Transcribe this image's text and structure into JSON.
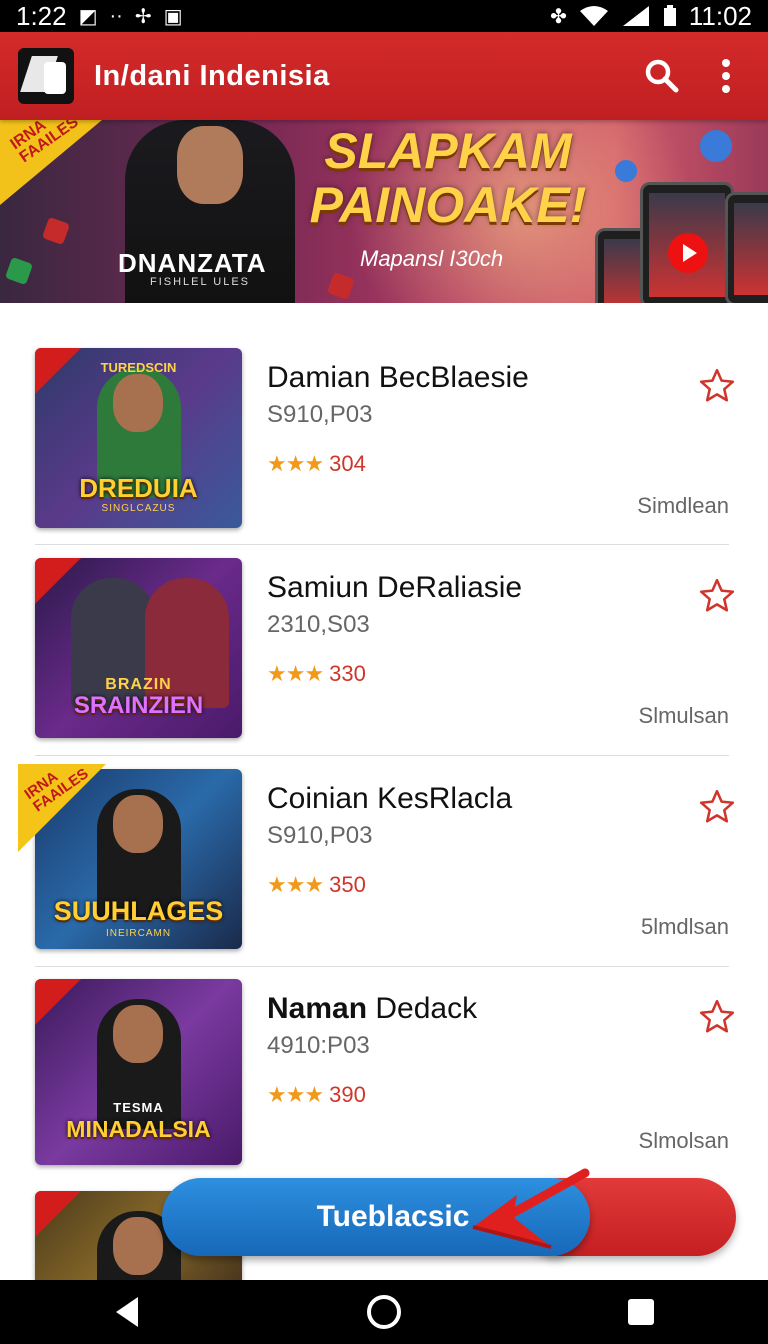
{
  "status_bar": {
    "time_left": "1:22",
    "time_right": "11:02"
  },
  "app_bar": {
    "title": "In/dani Indenisia"
  },
  "banner": {
    "ribbon_text": "IRNA FAAILES",
    "brand": "DNANZATA",
    "brand_sub": "FISHLEL ULES",
    "headline_line1": "SLAPKAM",
    "headline_line2": "PAINOAKE!",
    "subtitle": "Mapansl I30ch"
  },
  "items": [
    {
      "title": "Damian BecBlaesie",
      "price": "S910,P03",
      "rating": "304",
      "category": "Simdlean",
      "thumb_title": "DREDUIA",
      "thumb_sub": "SINGLCAZUS",
      "thumb_top": "TUREDSCIN"
    },
    {
      "title": "Samiun DeRaliasie",
      "price": "2310,S03",
      "rating": "330",
      "category": "Slmulsan",
      "thumb_title": "SRAINZIEN",
      "thumb_sub": "BRAZIN",
      "thumb_top": ""
    },
    {
      "title": "Coinian KesRlacla",
      "price": "S910,P03",
      "rating": "350",
      "category": "5lmdlsan",
      "thumb_title": "SUUHLAGES",
      "thumb_sub": "INEIRCAMN",
      "thumb_top": ""
    },
    {
      "title_bold": "Naman",
      "title_rest": " Dedack",
      "price": "4910:P03",
      "rating": "390",
      "category": "Slmolsan",
      "thumb_title": "MINADALSIA",
      "thumb_sub": "TESMA",
      "thumb_top": ""
    }
  ],
  "gold_ribbon_text": "IRNA FAAILES",
  "stars_glyph": "★★★",
  "cta": {
    "label": "Tueblacsic"
  },
  "colors": {
    "primary_red": "#c9232a",
    "cta_blue": "#1f7bcf",
    "star": "#f19a1a"
  }
}
